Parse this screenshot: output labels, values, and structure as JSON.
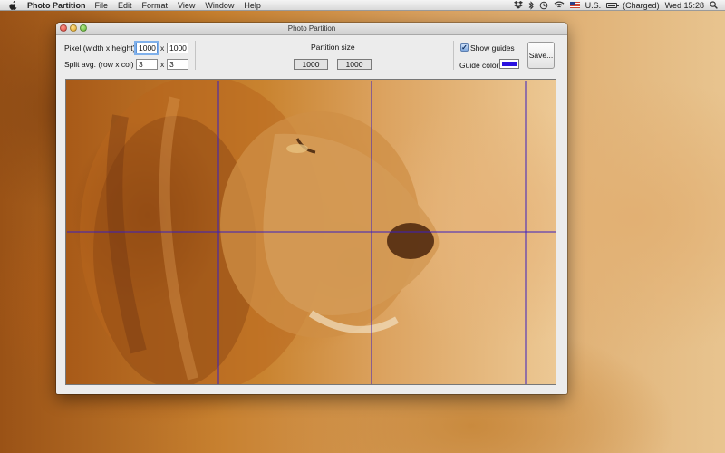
{
  "menubar": {
    "app_name": "Photo Partition",
    "menus": [
      "File",
      "Edit",
      "Format",
      "View",
      "Window",
      "Help"
    ],
    "input_source": "U.S.",
    "battery_status": "(Charged)",
    "clock": "Wed 15:28"
  },
  "window": {
    "title": "Photo Partition"
  },
  "toolbar": {
    "pixel_label": "Pixel (width x height)",
    "pixel_width": "1000",
    "pixel_height": "1000",
    "split_label": "Split avg. (row x col)",
    "split_rows": "3",
    "split_cols": "3",
    "times_symbol": "x",
    "partition_size_label": "Partition size",
    "partition_width": "1000",
    "partition_height": "1000",
    "show_guides_label": "Show guides",
    "show_guides_checked": true,
    "guide_color_label": "Guide color:",
    "guide_color": "#2a12e0",
    "save_label": "Save..."
  },
  "guides": {
    "rows": 2,
    "cols": 3,
    "color": "#3b1fbf"
  }
}
